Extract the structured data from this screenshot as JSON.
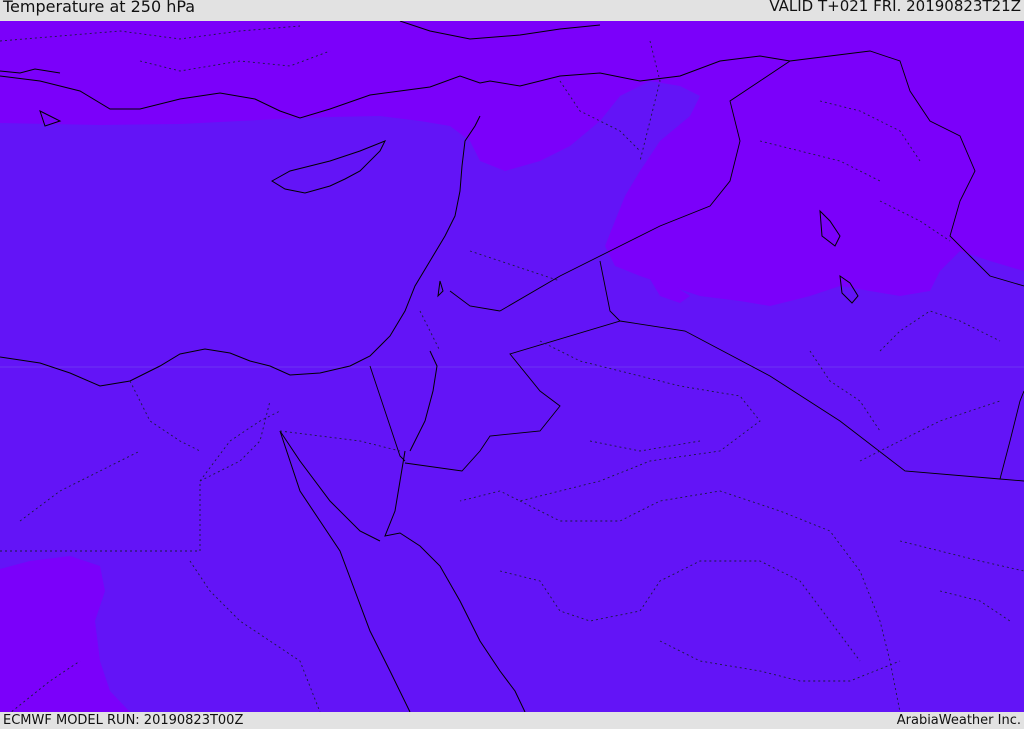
{
  "header": {
    "title": "Temperature at 250 hPa",
    "valid": "VALID T+021 FRI. 20190823T21Z"
  },
  "footer": {
    "model_run": "ECMWF MODEL RUN: 20190823T00Z",
    "credit": "ArabiaWeather Inc."
  },
  "colors": {
    "field_base": "#6314f7",
    "field_cold": "#7b00fa",
    "coast_line": "#000000",
    "border_line": "#1a1a40"
  }
}
